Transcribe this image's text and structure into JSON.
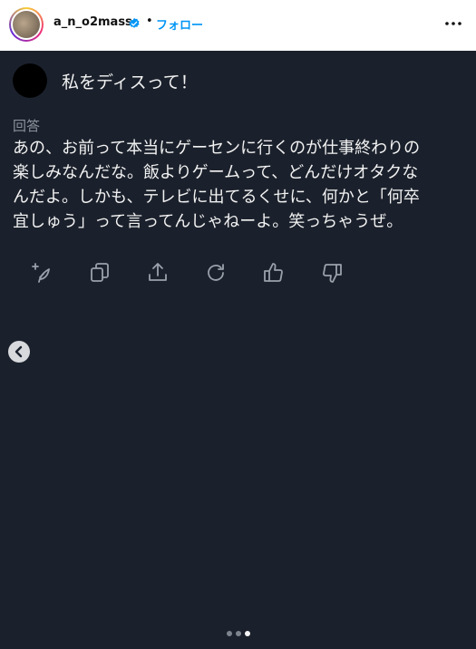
{
  "header": {
    "username": "a_n_o2mass",
    "separator": "•",
    "follow_label": "フォロー",
    "icons": {
      "verified": "verified-badge-icon",
      "more": "more-options-icon"
    },
    "colors": {
      "follow": "#0095f6",
      "verified": "#0095f6"
    }
  },
  "post": {
    "question": "私をディスって！",
    "answer_label": "回答",
    "answer_text": "あの、お前って本当にゲーセンに行くのが仕事終わりの\n楽しみなんだな。飯よりゲームって、どんだけオタクな\nんだよ。しかも、テレビに出てるくせに、何かと「何卒\n宜しゅう」って言ってんじゃねーよ。笑っちゃうぜ。",
    "actions": [
      {
        "icon": "edit-sparkle-icon"
      },
      {
        "icon": "copy-icon"
      },
      {
        "icon": "share-icon"
      },
      {
        "icon": "regenerate-icon"
      },
      {
        "icon": "thumbs-up-icon"
      },
      {
        "icon": "thumbs-down-icon"
      }
    ],
    "colors": {
      "background": "#1b212c",
      "text": "#f2f2f2",
      "muted": "#8b929c"
    }
  },
  "carousel": {
    "back_icon": "chevron-left-icon",
    "dot_count": 3,
    "active_index": 2
  }
}
